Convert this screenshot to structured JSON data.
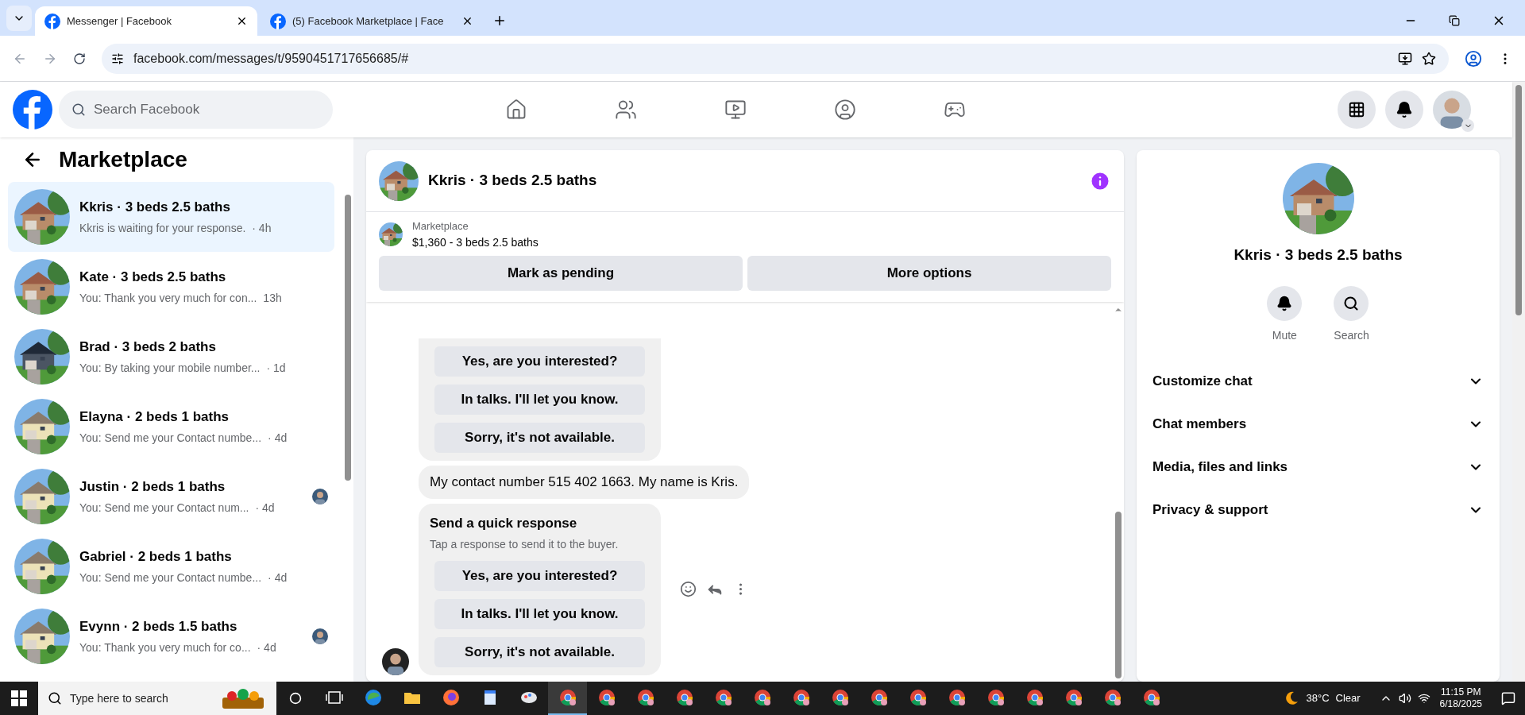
{
  "browser": {
    "tabs": [
      {
        "title": "Messenger | Facebook",
        "selected": true
      },
      {
        "title": "(5) Facebook Marketplace | Face",
        "selected": false
      }
    ],
    "url": "facebook.com/messages/t/9590451717656685/#"
  },
  "header": {
    "search": {
      "placeholder": "Search Facebook"
    }
  },
  "sidebar": {
    "title": "Marketplace",
    "items": [
      {
        "title": "Kkris · 3 beds 2.5 baths",
        "preview": "Kkris is waiting for your response.",
        "time": "· 4h",
        "selected": true,
        "seen": false
      },
      {
        "title": "Kate · 3 beds 2.5 baths",
        "preview": "You: Thank you very much for con...",
        "time": "13h",
        "selected": false,
        "seen": false
      },
      {
        "title": "Brad · 3 beds 2 baths",
        "preview": "You: By taking your mobile number...",
        "time": "· 1d",
        "selected": false,
        "seen": false
      },
      {
        "title": "Elayna · 2 beds 1 baths",
        "preview": "You: Send me your Contact numbe...",
        "time": "· 4d",
        "selected": false,
        "seen": false
      },
      {
        "title": "Justin · 2 beds 1 baths",
        "preview": "You: Send me your Contact num...",
        "time": "· 4d",
        "selected": false,
        "seen": true
      },
      {
        "title": "Gabriel · 2 beds 1 baths",
        "preview": "You: Send me your Contact numbe...",
        "time": "· 4d",
        "selected": false,
        "seen": false
      },
      {
        "title": "Evynn · 2 beds 1.5 baths",
        "preview": "You: Thank you very much for co...",
        "time": "· 4d",
        "selected": false,
        "seen": true
      }
    ]
  },
  "chat": {
    "title": "Kkris · 3 beds 2.5 baths",
    "listing": {
      "source": "Marketplace",
      "summary": "$1,360 - 3 beds 2.5 baths"
    },
    "actions": [
      "Mark as pending",
      "More options"
    ],
    "messages": [
      {
        "kind": "quick_response",
        "options": [
          "Yes, are you interested?",
          "In talks. I'll let you know.",
          "Sorry, it's not available."
        ]
      },
      {
        "kind": "text",
        "text": "My contact number 515 402 1663. My name is Kris."
      },
      {
        "kind": "quick_response",
        "title": "Send a quick response",
        "subtitle": "Tap a response to send it to the buyer.",
        "options": [
          "Yes, are you interested?",
          "In talks. I'll let you know.",
          "Sorry, it's not available."
        ]
      }
    ]
  },
  "details": {
    "title": "Kkris · 3 beds 2.5 baths",
    "buttons": [
      {
        "kind": "mute",
        "label": "Mute"
      },
      {
        "kind": "search",
        "label": "Search"
      }
    ],
    "sections": [
      {
        "label": "Customize chat",
        "expanded": false
      },
      {
        "label": "Chat members",
        "expanded": false
      },
      {
        "label": "Media, files and links",
        "expanded": false
      },
      {
        "label": "Privacy & support",
        "expanded": false
      }
    ]
  },
  "taskbar": {
    "search": {
      "placeholder": "Type here to search"
    },
    "apps": [
      {
        "kind": "taskview",
        "selected": false
      },
      {
        "kind": "edge",
        "selected": false
      },
      {
        "kind": "explorer",
        "selected": false
      },
      {
        "kind": "firefox",
        "selected": false
      },
      {
        "kind": "notepad",
        "selected": false
      },
      {
        "kind": "paint",
        "selected": false
      },
      {
        "kind": "chrome",
        "selected": true
      },
      {
        "kind": "chrome",
        "selected": false
      },
      {
        "kind": "chrome",
        "selected": false
      },
      {
        "kind": "chrome",
        "selected": false
      },
      {
        "kind": "chrome",
        "selected": false
      },
      {
        "kind": "chrome",
        "selected": false
      },
      {
        "kind": "chrome",
        "selected": false
      },
      {
        "kind": "chrome",
        "selected": false
      },
      {
        "kind": "chrome",
        "selected": false
      },
      {
        "kind": "chrome",
        "selected": false
      },
      {
        "kind": "chrome",
        "selected": false
      },
      {
        "kind": "chrome",
        "selected": false
      },
      {
        "kind": "chrome",
        "selected": false
      },
      {
        "kind": "chrome",
        "selected": false
      },
      {
        "kind": "chrome",
        "selected": false
      },
      {
        "kind": "chrome",
        "selected": false
      }
    ],
    "weather": {
      "temp": "38°C",
      "condition": "Clear"
    },
    "time": "11:15 PM",
    "date": "6/18/2025"
  }
}
